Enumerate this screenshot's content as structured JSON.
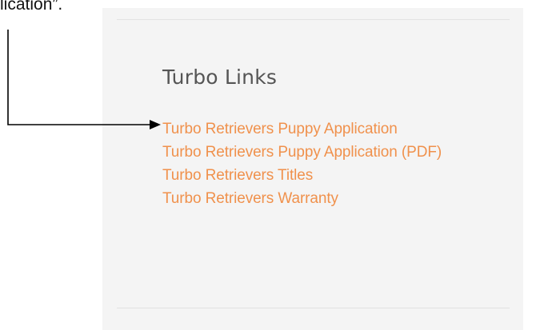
{
  "annotation": {
    "caption_fragment": "lication”."
  },
  "sidebar": {
    "widget_title": "Turbo Links",
    "links": [
      "Turbo Retrievers Puppy Application",
      "Turbo Retrievers Puppy Application (PDF)",
      "Turbo Retrievers Titles",
      "Turbo Retrievers Warranty"
    ],
    "colors": {
      "panel_background": "#f4f4f4",
      "link_color": "#f0914c",
      "title_color": "#555555",
      "arrow_color": "#000000"
    }
  }
}
